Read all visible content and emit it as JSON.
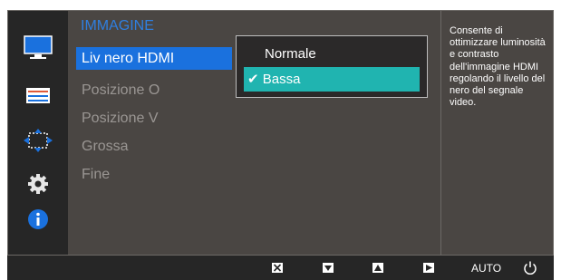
{
  "menu": {
    "title": "IMMAGINE",
    "items": [
      "Liv nero HDMI",
      "Posizione O",
      "Posizione V",
      "Grossa",
      "Fine"
    ]
  },
  "submenu": {
    "options": [
      "Normale",
      "Bassa"
    ],
    "check_mark": "✔"
  },
  "help": {
    "text": "Consente di ottimizzare luminosità e contrasto dell'immagine HDMI regolando il livello del nero del segnale video."
  },
  "bottom_bar": {
    "auto_label": "AUTO",
    "buttons": [
      "close-icon",
      "down-arrow-icon",
      "up-arrow-icon",
      "right-arrow-icon",
      "power-icon"
    ]
  },
  "sidebar": {
    "icons": [
      "monitor-icon",
      "settings-bars-icon",
      "resize-arrows-icon",
      "gear-icon",
      "info-icon"
    ]
  },
  "colors": {
    "selected_item": "#1a71de",
    "selected_option": "#20b4b0",
    "title": "#2f7fe0"
  }
}
